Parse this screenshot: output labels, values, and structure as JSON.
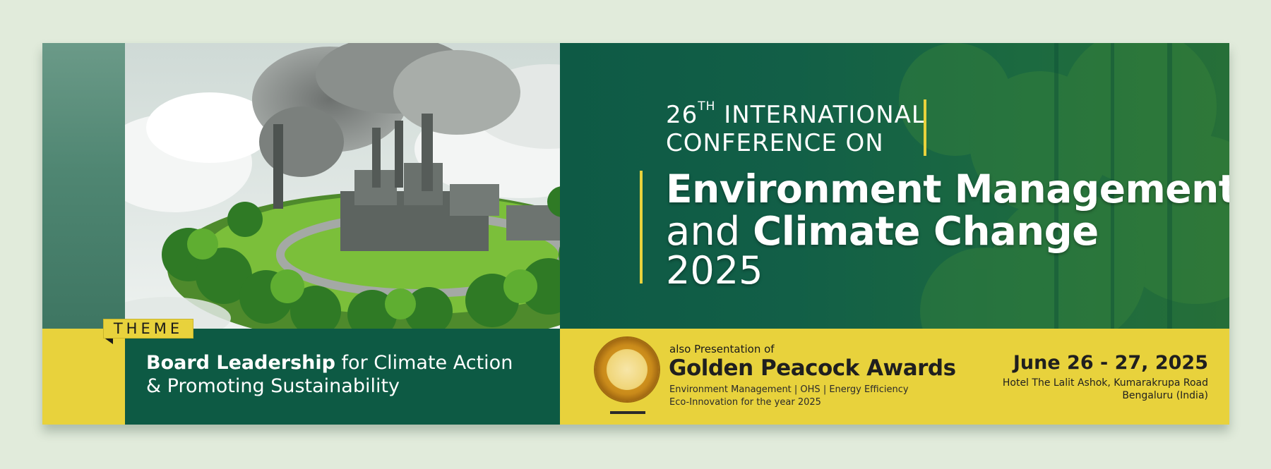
{
  "conference": {
    "edition_number": "26",
    "edition_suffix": "TH",
    "line1_rest": " INTERNATIONAL",
    "line2": "CONFERENCE ON",
    "title_line1": "Environment Management",
    "title_line2_prefix": "and ",
    "title_line2_bold": "Climate Change",
    "year": "2025"
  },
  "theme": {
    "tag": "THEME",
    "bold": "Board Leadership",
    "rest_line1": " for Climate Action",
    "line2": "& Promoting Sustainability"
  },
  "awards": {
    "intro": "also Presentation of",
    "title": "Golden Peacock Awards",
    "categories": "Environment Management | OHS | Energy Efficiency",
    "categories_line2": "Eco-Innovation for the year 2025"
  },
  "event": {
    "date": "June 26 - 27, 2025",
    "venue_line1": "Hotel The Lalit Ashok, Kumarakrupa Road",
    "venue_line2": "Bengaluru (India)"
  },
  "colors": {
    "brand_green": "#0d5a44",
    "accent_yellow": "#e8d23c",
    "page_background": "#e1ebdb"
  }
}
